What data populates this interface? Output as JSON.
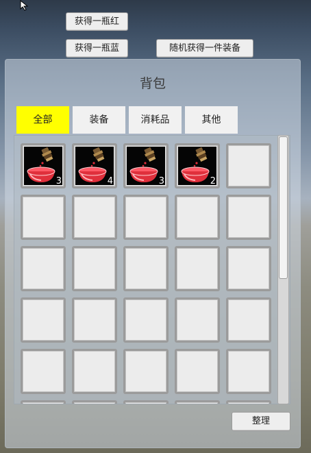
{
  "buttons": {
    "get_red": "获得一瓶红",
    "get_blue": "获得一瓶蓝",
    "random_equipment": "随机获得一件装备",
    "sort": "整理"
  },
  "bag": {
    "title": "背包",
    "tabs": [
      {
        "label": "全部",
        "active": true
      },
      {
        "label": "装备",
        "active": false
      },
      {
        "label": "消耗品",
        "active": false
      },
      {
        "label": "其他",
        "active": false
      }
    ],
    "columns": 5,
    "visible_rows": 6,
    "slots": [
      {
        "item": "red-potion-icon",
        "count": "3"
      },
      {
        "item": "red-potion-icon",
        "count": "4"
      },
      {
        "item": "red-potion-icon",
        "count": "3"
      },
      {
        "item": "red-potion-icon",
        "count": "2"
      }
    ],
    "scroll_position": 0,
    "scroll_visible_fraction": 0.53
  },
  "colors": {
    "active_tab": "#ffff00",
    "potion": "#e0303c"
  }
}
